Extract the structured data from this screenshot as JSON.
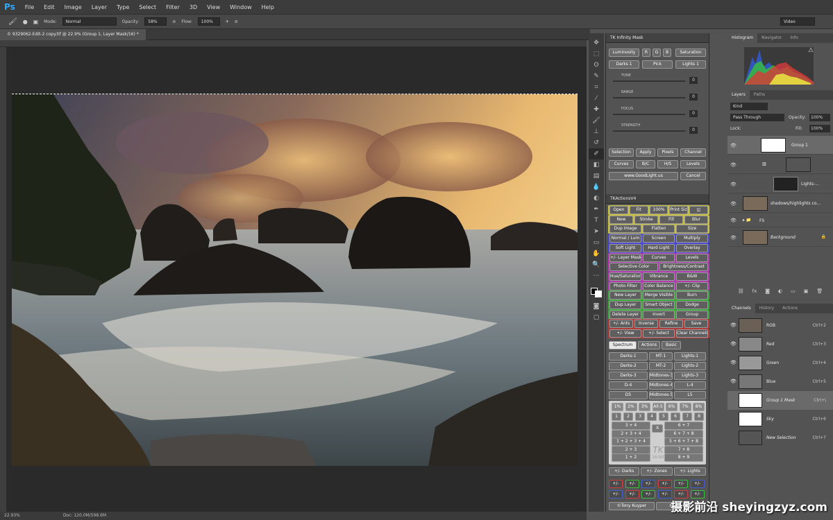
{
  "app": {
    "logo": "Ps",
    "menu": [
      "File",
      "Edit",
      "Image",
      "Layer",
      "Type",
      "Select",
      "Filter",
      "3D",
      "View",
      "Window",
      "Help"
    ]
  },
  "options": {
    "mode_label": "Mode:",
    "mode_value": "Normal",
    "opacity_label": "Opacity:",
    "opacity_value": "58%",
    "flow_label": "Flow:",
    "flow_value": "100%",
    "workspace": "Video"
  },
  "document": {
    "tab_title": "© 9329062-Edit-2 copy.tif @ 22.9% (Group 1, Layer Mask/16) *",
    "zoom": "22.93%",
    "doc_size": "Doc: 120.0M/598.6M"
  },
  "tk_infinity": {
    "title": "TK Infinity Mask",
    "row1": [
      "Luminosity",
      "R",
      "G",
      "B",
      "Saturation"
    ],
    "row2": [
      "Darks 1",
      "Pick",
      "Lights 1"
    ],
    "sliders": [
      {
        "label": "TONE",
        "value": "0"
      },
      {
        "label": "RANGE",
        "value": "0"
      },
      {
        "label": "FOCUS",
        "value": "0"
      },
      {
        "label": "STRENGTH",
        "value": "0"
      }
    ],
    "row3": [
      "Selection",
      "Apply",
      "Pixels",
      "Channel"
    ],
    "row4": [
      "Curves",
      "B/C",
      "H/S",
      "Levels"
    ],
    "row5": [
      "www.GoodLight.us",
      "Cancel"
    ]
  },
  "tk_actions": {
    "title": "TKActionsV4",
    "rows": [
      {
        "color": "#c8c040",
        "buttons": [
          "Open",
          "Fit",
          "100%",
          "Print Size",
          "◱"
        ]
      },
      {
        "color": "#c8c040",
        "buttons": [
          "New",
          "Stroke",
          "Fill",
          "Blur"
        ]
      },
      {
        "color": "#c8c040",
        "buttons": [
          "Dup Image",
          "Flatten",
          "Size"
        ]
      },
      {
        "color": "#4a4ad0",
        "buttons": [
          "Normal / Lum",
          "Screen",
          "Multiply"
        ]
      },
      {
        "color": "#4a4ad0",
        "buttons": [
          "Soft Light",
          "Hard Light",
          "Overlay"
        ]
      },
      {
        "color": "#b03ab0",
        "buttons": [
          "+/- Layer Mask",
          "Curves",
          "Levels"
        ]
      },
      {
        "color": "#b03ab0",
        "buttons": [
          "Selective Color",
          "Brightness/Contrast"
        ]
      },
      {
        "color": "#b03ab0",
        "buttons": [
          "Hue/Saturation",
          "Vibrance",
          "B&W"
        ]
      },
      {
        "color": "#b03ab0",
        "buttons": [
          "Photo Filter",
          "Color Balance",
          "+/- Clip"
        ]
      },
      {
        "color": "#3aa83a",
        "buttons": [
          "New Layer",
          "Merge Visible",
          "Burn"
        ]
      },
      {
        "color": "#3aa83a",
        "buttons": [
          "Dup Layer",
          "Smart Object",
          "Dodge"
        ]
      },
      {
        "color": "#3aa83a",
        "buttons": [
          "Delete Layer",
          "Invert",
          "Group"
        ]
      },
      {
        "color": "#b03a3a",
        "buttons": [
          "+/- Ants",
          "Inverse",
          "Refine",
          "Save"
        ]
      },
      {
        "color": "#b03a3a",
        "buttons": [
          "+/- View",
          "+/- Select",
          "Clear Channels"
        ]
      }
    ]
  },
  "spectrum": {
    "tabs": [
      "Spectrum",
      "Actions",
      "Basic"
    ],
    "rows": [
      [
        "Darks-1",
        "MT-1",
        "Lights-1"
      ],
      [
        "Darks-2",
        "MT-2",
        "Lights-2"
      ],
      [
        "Darks-3",
        "Midtones-3",
        "Lights-3"
      ],
      [
        "D-4",
        "Midtones-4",
        "L-4"
      ],
      [
        "D5",
        "Midtones-5",
        "L5"
      ]
    ],
    "percent": [
      "1%",
      "2%",
      "3%",
      "All-5",
      "6%",
      "7%",
      "8%"
    ],
    "zone_nums": [
      "1",
      "2",
      "3",
      "4",
      "5",
      "6",
      "7",
      "8"
    ],
    "zones_left": [
      "3 + 4",
      "2 + 3 + 4",
      "1 + 2 + 3 + 4",
      "2 + 3",
      "1 + 2"
    ],
    "zones_right": [
      "6 + 7",
      "6 + 7 + 8",
      "5 + 6 + 7 + 8",
      "7 + 8",
      "8 + 9"
    ],
    "x_label": "X",
    "logo": "TK",
    "logo_sub": "16-bit",
    "bottom": [
      "+/- Darks",
      "+/- Zones",
      "+/- Lights"
    ],
    "pm": "+/-",
    "footer": [
      "©Tony Kuyper",
      "Help / User"
    ]
  },
  "histogram": {
    "tabs": [
      "Histogram",
      "Navigator",
      "Info"
    ]
  },
  "layers_panel": {
    "tabs": [
      "Layers",
      "Paths"
    ],
    "filter": "Kind",
    "blend": "Pass Through",
    "opacity_label": "Opacity:",
    "opacity": "100%",
    "lock_label": "Lock:",
    "fill_label": "Fill:",
    "fill": "100%",
    "layers": [
      "Group 1",
      "",
      "Lights-...",
      "shadows/highlights co...",
      "FS",
      "Background"
    ]
  },
  "channels_panel": {
    "tabs": [
      "Channels",
      "History",
      "Actions"
    ],
    "channels": [
      {
        "name": "RGB",
        "shortcut": "Ctrl+2"
      },
      {
        "name": "Red",
        "shortcut": "Ctrl+3"
      },
      {
        "name": "Green",
        "shortcut": "Ctrl+4"
      },
      {
        "name": "Blue",
        "shortcut": "Ctrl+5"
      },
      {
        "name": "Group 1 Mask",
        "shortcut": "Ctrl+\\"
      },
      {
        "name": "Sky",
        "shortcut": "Ctrl+6"
      },
      {
        "name": "New Selection",
        "shortcut": "Ctrl+7"
      }
    ]
  },
  "watermark": "摄影前沿 sheyingzyz.com"
}
